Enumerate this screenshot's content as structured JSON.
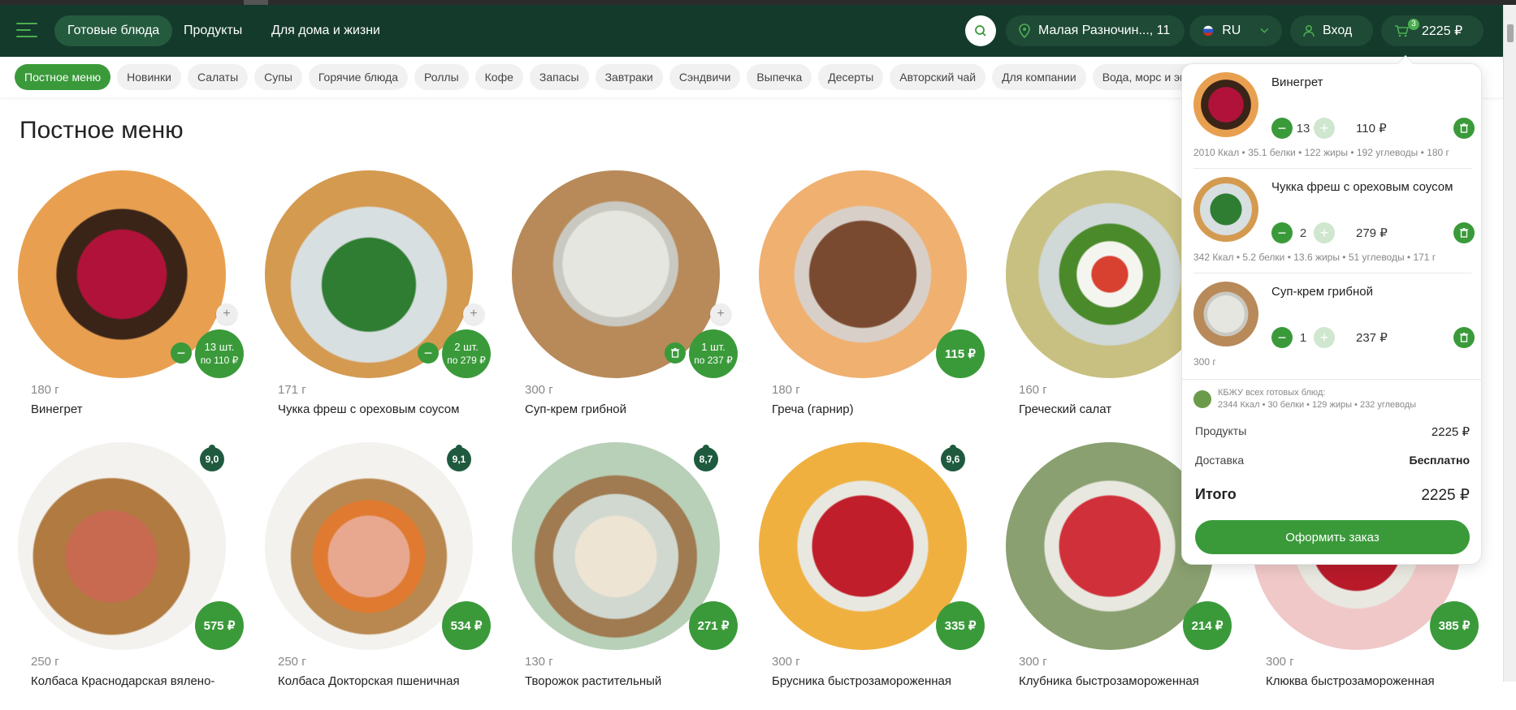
{
  "header": {
    "nav": [
      "Готовые блюда",
      "Продукты",
      "Для дома и жизни"
    ],
    "address": "Малая Разночин..., 11",
    "language": "RU",
    "login": "Вход",
    "cart_count": "3",
    "cart_total": "2225 ₽"
  },
  "categories": [
    "Постное меню",
    "Новинки",
    "Салаты",
    "Супы",
    "Горячие блюда",
    "Роллы",
    "Кофе",
    "Запасы",
    "Завтраки",
    "Сэндвичи",
    "Выпечка",
    "Десерты",
    "Авторский чай",
    "Для компании",
    "Вода, морс и энергетики"
  ],
  "page_title": "Постное меню",
  "products_row1": [
    {
      "weight": "180 г",
      "name": "Винегрет",
      "qty_label": "13 шт.",
      "qty_price": "по 110 ₽"
    },
    {
      "weight": "171 г",
      "name": "Чукка фреш с ореховым соусом",
      "qty_label": "2 шт.",
      "qty_price": "по 279 ₽"
    },
    {
      "weight": "300 г",
      "name": "Суп-крем грибной",
      "qty_label": "1 шт.",
      "qty_price": "по 237 ₽"
    },
    {
      "weight": "180 г",
      "name": "Греча (гарнир)",
      "price": "115 ₽"
    },
    {
      "weight": "160 г",
      "name": "Греческий салат",
      "price": ""
    }
  ],
  "products_row2": [
    {
      "weight": "250 г",
      "name": "Колбаса Краснодарская вялено-",
      "price": "575 ₽",
      "rating": "9,0"
    },
    {
      "weight": "250 г",
      "name": "Колбаса Докторская пшеничная",
      "price": "534 ₽",
      "rating": "9,1"
    },
    {
      "weight": "130 г",
      "name": "Творожок растительный",
      "price": "271 ₽",
      "rating": "8,7"
    },
    {
      "weight": "300 г",
      "name": "Брусника быстрозамороженная",
      "price": "335 ₽",
      "rating": "9,6"
    },
    {
      "weight": "300 г",
      "name": "Клубника быстрозамороженная",
      "price": "214 ₽",
      "rating": ""
    },
    {
      "weight": "300 г",
      "name": "Клюква быстрозамороженная",
      "price": "385 ₽",
      "rating": ""
    }
  ],
  "cart": {
    "items": [
      {
        "name": "Винегрет",
        "qty": "13",
        "price": "110 ₽",
        "nutrition": "2010 Ккал • 35.1 белки • 122 жиры • 192 углеводы • 180 г"
      },
      {
        "name": "Чукка фреш с ореховым соусом",
        "qty": "2",
        "price": "279 ₽",
        "nutrition": "342 Ккал • 5.2 белки • 13.6 жиры • 51 углеводы • 171 г"
      },
      {
        "name": "Суп-крем грибной",
        "qty": "1",
        "price": "237 ₽",
        "nutrition": "300 г"
      }
    ],
    "kbju_title": "КБЖУ всех готовых блюд:",
    "kbju_values": "2344 Ккал • 30 белки • 129 жиры • 232 углеводы",
    "products_label": "Продукты",
    "products_value": "2225 ₽",
    "delivery_label": "Доставка",
    "delivery_value": "Бесплатно",
    "total_label": "Итого",
    "total_value": "2225 ₽",
    "order_button": "Оформить заказ"
  }
}
